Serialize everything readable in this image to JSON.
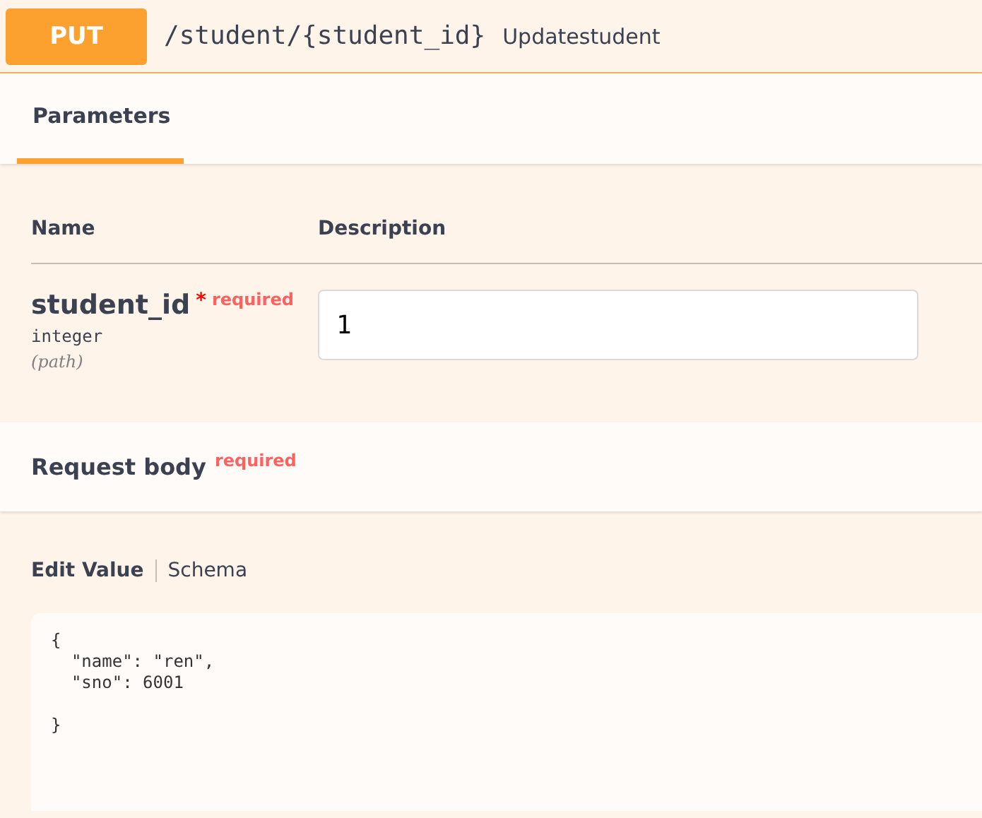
{
  "operation": {
    "method": "PUT",
    "path": "/student/{student_id}",
    "summary": "Updatestudent"
  },
  "tabs": [
    {
      "label": "Parameters",
      "selected": true
    }
  ],
  "parameters": {
    "columns": [
      "Name",
      "Description"
    ],
    "rows": [
      {
        "name": "student_id",
        "required": true,
        "required_mark": "*",
        "required_label": "required",
        "type": "integer",
        "location": "(path)",
        "value": "1"
      }
    ]
  },
  "request_body": {
    "title": "Request body",
    "required": true,
    "required_label": "required",
    "tabs": [
      {
        "label": "Edit Value",
        "selected": true
      },
      {
        "label": "Schema",
        "selected": false
      }
    ],
    "value": "{\n  \"name\": \"ren\",\n  \"sno\": 6001\n\n}"
  }
}
